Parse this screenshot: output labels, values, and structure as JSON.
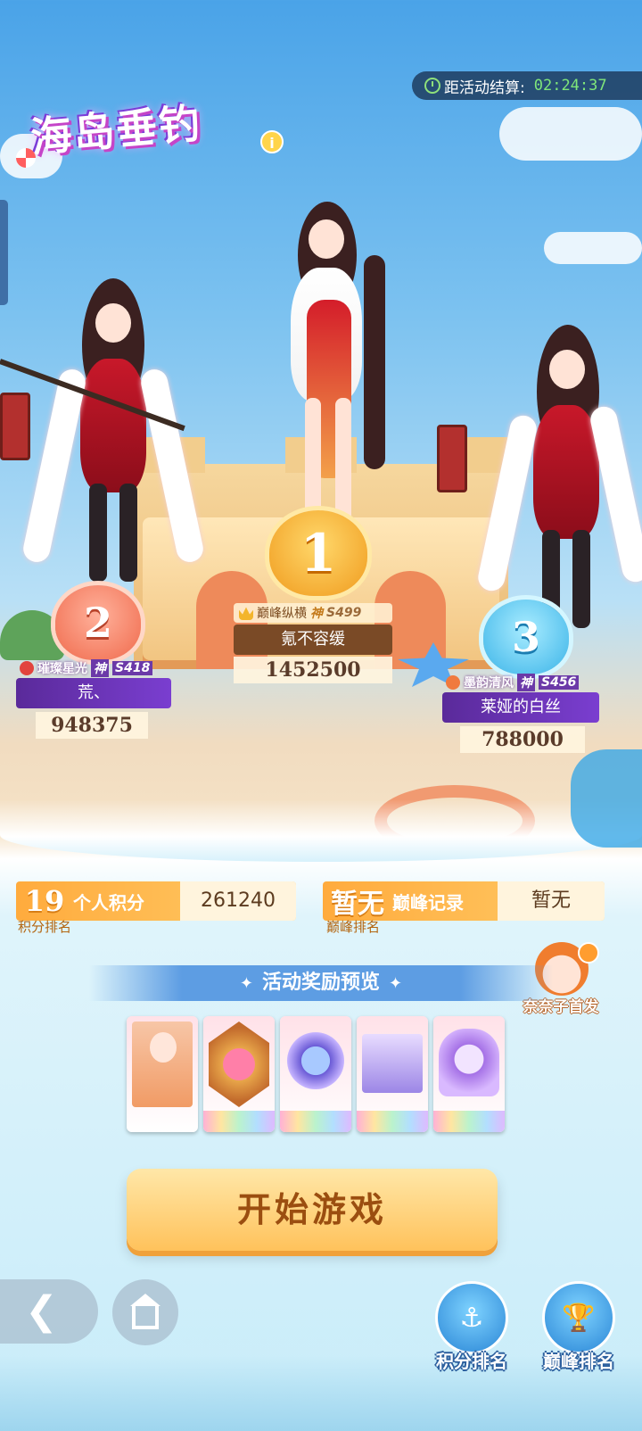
{
  "timer": {
    "label": "距活动结算:",
    "time": "02:24:37"
  },
  "logo": {
    "title": "海岛垂钓",
    "info": "i"
  },
  "podium": {
    "first": {
      "rank": "1",
      "title": "巅峰纵横",
      "tier": "神",
      "server": "S499",
      "name": "氪不容缓",
      "score": "1452500"
    },
    "second": {
      "rank": "2",
      "title": "璀璨星光",
      "tier": "神",
      "server": "S418",
      "name": "荒、",
      "score": "948375"
    },
    "third": {
      "rank": "3",
      "title": "墨韵清风",
      "tier": "神",
      "server": "S456",
      "name": "莱娅的白丝",
      "score": "788000"
    }
  },
  "stats": {
    "personal": {
      "rank": "19",
      "label": "个人积分",
      "value": "261240",
      "sub": "积分排名"
    },
    "peak": {
      "rank": "暂无",
      "label": "巅峰记录",
      "value": "暂无",
      "sub": "巅峰排名"
    }
  },
  "mascot": {
    "label": "奈奈子首发"
  },
  "rewards": {
    "title": "活动奖励预览",
    "items": [
      "character-card",
      "heart-medal",
      "avatar-frame",
      "treasure-box",
      "ring-box"
    ]
  },
  "start_button": "开始游戏",
  "bottom": {
    "points_rank": "积分排名",
    "peak_rank": "巅峰排名"
  },
  "colors": {
    "accent": "#ffb545",
    "sky": "#4aa3e8",
    "timer_text": "#7fe67a"
  }
}
